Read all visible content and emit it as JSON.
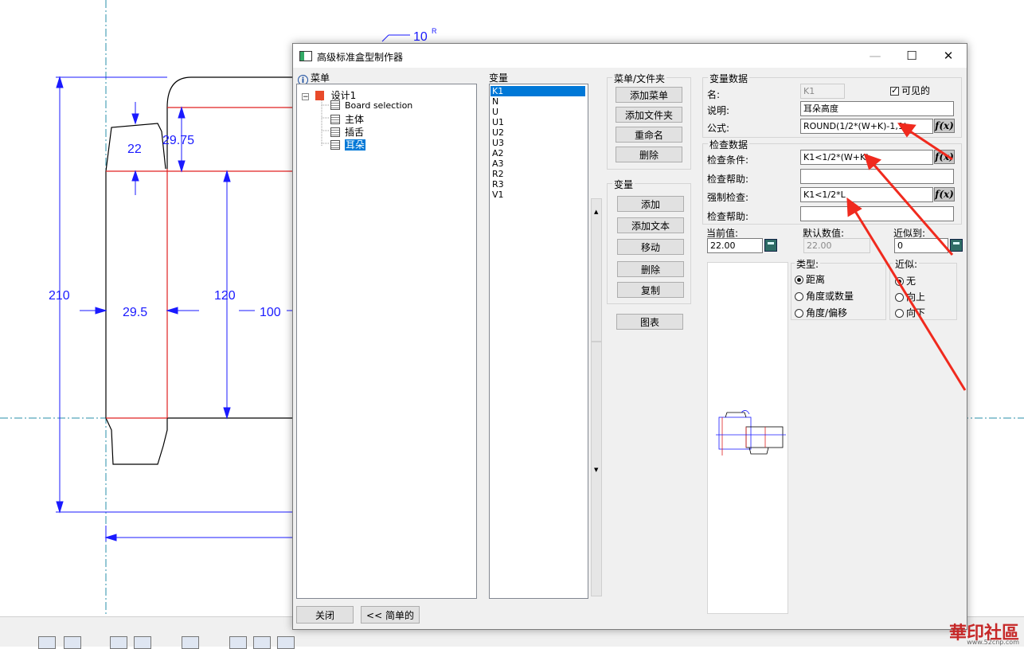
{
  "cad": {
    "dim_10r": "10",
    "dim_10r_sup": "R",
    "dim_22": "22",
    "dim_2975": "29.75",
    "dim_210": "210",
    "dim_295": "29.5",
    "dim_120": "120",
    "dim_100": "100"
  },
  "dialog": {
    "title": "高级标准盒型制作器",
    "menu_header": "菜单",
    "tree": {
      "root": "设计1",
      "children": [
        "Board selection",
        "主体",
        "插舌",
        "耳朵"
      ],
      "selected": "耳朵"
    },
    "var_header": "变量",
    "variables": [
      "K1",
      "N",
      "U",
      "U1",
      "U2",
      "U3",
      "A2",
      "A3",
      "R2",
      "R3",
      "V1"
    ],
    "selected_variable": "K1",
    "menu_folder_group": {
      "title": "菜单/文件夹",
      "buttons": [
        "添加菜单",
        "添加文件夹",
        "重命名",
        "删除"
      ]
    },
    "variable_group": {
      "title": "变量",
      "buttons": [
        "添加",
        "添加文本",
        "移动",
        "删除",
        "复制"
      ]
    },
    "chart_button": "图表",
    "var_data": {
      "title": "变量数据",
      "name_label": "名:",
      "name_value": "K1",
      "visible_label": "可见的",
      "desc_label": "说明:",
      "desc_value": "耳朵高度",
      "formula_label": "公式:",
      "formula_value": "ROUND(1/2*(W+K)-1,1)",
      "fx_label": "f(x)"
    },
    "check_data": {
      "title": "检查数据",
      "cond_label": "检查条件:",
      "cond_value": "K1<1/2*(W+K)",
      "help1_label": "检查帮助:",
      "force_label": "强制检查:",
      "force_value": "K1<1/2*L",
      "help2_label": "检查帮助:"
    },
    "current_label": "当前值:",
    "current_value": "22.00",
    "default_label": "默认数值:",
    "default_value": "22.00",
    "approx_label": "近似到:",
    "approx_value": "0",
    "type_group": {
      "title": "类型:",
      "options": [
        "距离",
        "角度或数量",
        "角度/偏移"
      ],
      "selected_index": 0
    },
    "approx_group": {
      "title": "近似:",
      "options": [
        "无",
        "向上",
        "向下"
      ],
      "selected_index": 0
    },
    "close_button": "关闭",
    "simple_button": "<< 简单的"
  },
  "watermark": {
    "text": "華印社區",
    "url": "www.52cnp.com"
  },
  "colors": {
    "cad_dim": "#1a1aff",
    "cad_red": "#e02020",
    "cad_center": "#2a8fa8",
    "arrow": "#f02a1e",
    "selection": "#0078d7"
  }
}
